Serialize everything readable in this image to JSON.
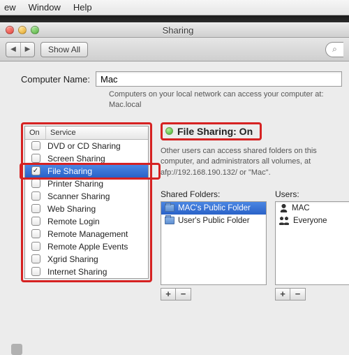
{
  "menubar": {
    "items": [
      "ew",
      "Window",
      "Help"
    ]
  },
  "window": {
    "title": "Sharing",
    "show_all_label": "Show All"
  },
  "computer_name": {
    "label": "Computer Name:",
    "value": "Mac",
    "hint_line1": "Computers on your local network can access your computer at:",
    "hint_line2": "Mac.local"
  },
  "services": {
    "col_on": "On",
    "col_service": "Service",
    "items": [
      {
        "label": "DVD or CD Sharing",
        "checked": false,
        "selected": false
      },
      {
        "label": "Screen Sharing",
        "checked": false,
        "selected": false
      },
      {
        "label": "File Sharing",
        "checked": true,
        "selected": true
      },
      {
        "label": "Printer Sharing",
        "checked": false,
        "selected": false
      },
      {
        "label": "Scanner Sharing",
        "checked": false,
        "selected": false
      },
      {
        "label": "Web Sharing",
        "checked": false,
        "selected": false
      },
      {
        "label": "Remote Login",
        "checked": false,
        "selected": false
      },
      {
        "label": "Remote Management",
        "checked": false,
        "selected": false
      },
      {
        "label": "Remote Apple Events",
        "checked": false,
        "selected": false
      },
      {
        "label": "Xgrid Sharing",
        "checked": false,
        "selected": false
      },
      {
        "label": "Internet Sharing",
        "checked": false,
        "selected": false
      }
    ]
  },
  "status": {
    "title": "File Sharing: On",
    "description": "Other users can access shared folders on this computer, and administrators all volumes, at afp://192.168.190.132/ or \"Mac\"."
  },
  "shared_folders": {
    "heading": "Shared Folders:",
    "items": [
      {
        "label": "MAC's Public Folder",
        "selected": true
      },
      {
        "label": "User's Public Folder",
        "selected": false
      }
    ]
  },
  "users": {
    "heading": "Users:",
    "items": [
      {
        "label": "MAC",
        "icon": "single"
      },
      {
        "label": "Everyone",
        "icon": "group"
      }
    ]
  },
  "pm": {
    "plus": "+",
    "minus": "−"
  },
  "highlight_color": "#d62222"
}
